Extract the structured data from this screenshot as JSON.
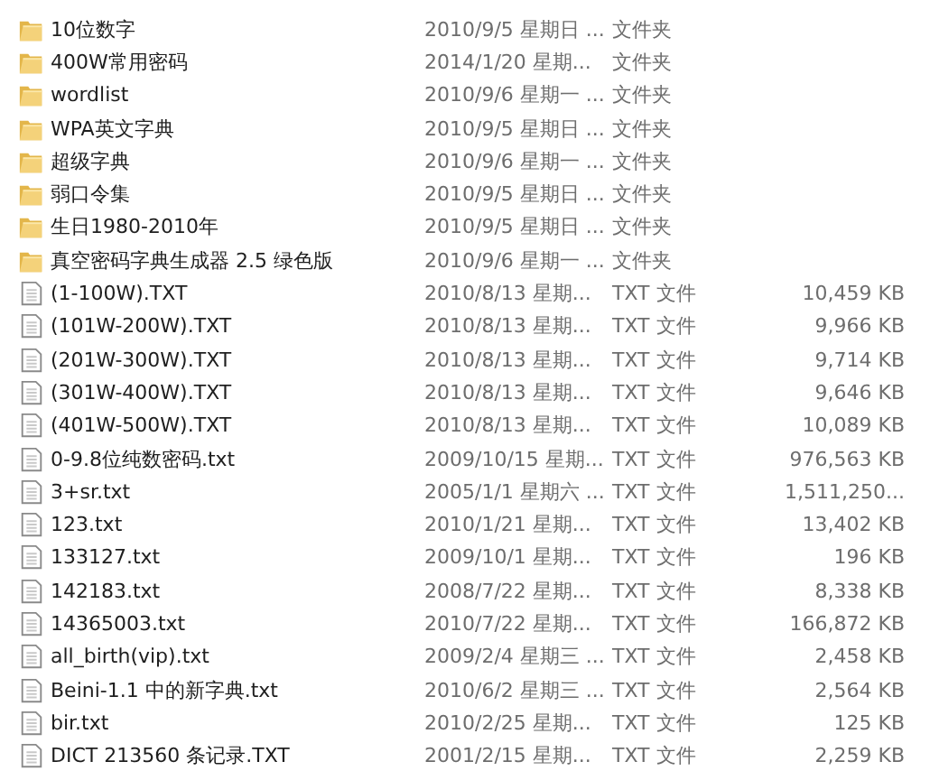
{
  "files": [
    {
      "kind": "folder",
      "name": "10位数字",
      "modified": "2010/9/5 星期日 ...",
      "type": "文件夹"
    },
    {
      "kind": "folder",
      "name": "400W常用密码",
      "modified": "2014/1/20 星期...",
      "type": "文件夹"
    },
    {
      "kind": "folder",
      "name": "wordlist",
      "modified": "2010/9/6 星期一 ...",
      "type": "文件夹"
    },
    {
      "kind": "folder",
      "name": "WPA英文字典",
      "modified": "2010/9/5 星期日 ...",
      "type": "文件夹"
    },
    {
      "kind": "folder",
      "name": "超级字典",
      "modified": "2010/9/6 星期一 ...",
      "type": "文件夹"
    },
    {
      "kind": "folder",
      "name": "弱口令集",
      "modified": "2010/9/5 星期日 ...",
      "type": "文件夹"
    },
    {
      "kind": "folder",
      "name": "生日1980-2010年",
      "modified": "2010/9/5 星期日 ...",
      "type": "文件夹"
    },
    {
      "kind": "folder",
      "name": "真空密码字典生成器 2.5 绿色版",
      "modified": "2010/9/6 星期一 ...",
      "type": "文件夹"
    },
    {
      "kind": "file",
      "name": "(1-100W).TXT",
      "modified": "2010/8/13 星期...",
      "type": "TXT 文件",
      "size": "10,459 KB"
    },
    {
      "kind": "file",
      "name": "(101W-200W).TXT",
      "modified": "2010/8/13 星期...",
      "type": "TXT 文件",
      "size": "9,966 KB"
    },
    {
      "kind": "file",
      "name": "(201W-300W).TXT",
      "modified": "2010/8/13 星期...",
      "type": "TXT 文件",
      "size": "9,714 KB"
    },
    {
      "kind": "file",
      "name": "(301W-400W).TXT",
      "modified": "2010/8/13 星期...",
      "type": "TXT 文件",
      "size": "9,646 KB"
    },
    {
      "kind": "file",
      "name": "(401W-500W).TXT",
      "modified": "2010/8/13 星期...",
      "type": "TXT 文件",
      "size": "10,089 KB"
    },
    {
      "kind": "file",
      "name": "0-9.8位纯数密码.txt",
      "modified": "2009/10/15 星期...",
      "type": "TXT 文件",
      "size": "976,563 KB"
    },
    {
      "kind": "file",
      "name": "3+sr.txt",
      "modified": "2005/1/1 星期六 ...",
      "type": "TXT 文件",
      "size": "1,511,250..."
    },
    {
      "kind": "file",
      "name": "123.txt",
      "modified": "2010/1/21 星期...",
      "type": "TXT 文件",
      "size": "13,402 KB"
    },
    {
      "kind": "file",
      "name": "133127.txt",
      "modified": "2009/10/1 星期...",
      "type": "TXT 文件",
      "size": "196 KB"
    },
    {
      "kind": "file",
      "name": "142183.txt",
      "modified": "2008/7/22 星期...",
      "type": "TXT 文件",
      "size": "8,338 KB"
    },
    {
      "kind": "file",
      "name": "14365003.txt",
      "modified": "2010/7/22 星期...",
      "type": "TXT 文件",
      "size": "166,872 KB"
    },
    {
      "kind": "file",
      "name": "all_birth(vip).txt",
      "modified": "2009/2/4 星期三 ...",
      "type": "TXT 文件",
      "size": "2,458 KB"
    },
    {
      "kind": "file",
      "name": "Beini-1.1 中的新字典.txt",
      "modified": "2010/6/2 星期三 ...",
      "type": "TXT 文件",
      "size": "2,564 KB"
    },
    {
      "kind": "file",
      "name": "bir.txt",
      "modified": "2010/2/25 星期...",
      "type": "TXT 文件",
      "size": "125 KB"
    },
    {
      "kind": "file",
      "name": "DICT 213560 条记录.TXT",
      "modified": "2001/2/15 星期...",
      "type": "TXT 文件",
      "size": "2,259 KB"
    }
  ]
}
